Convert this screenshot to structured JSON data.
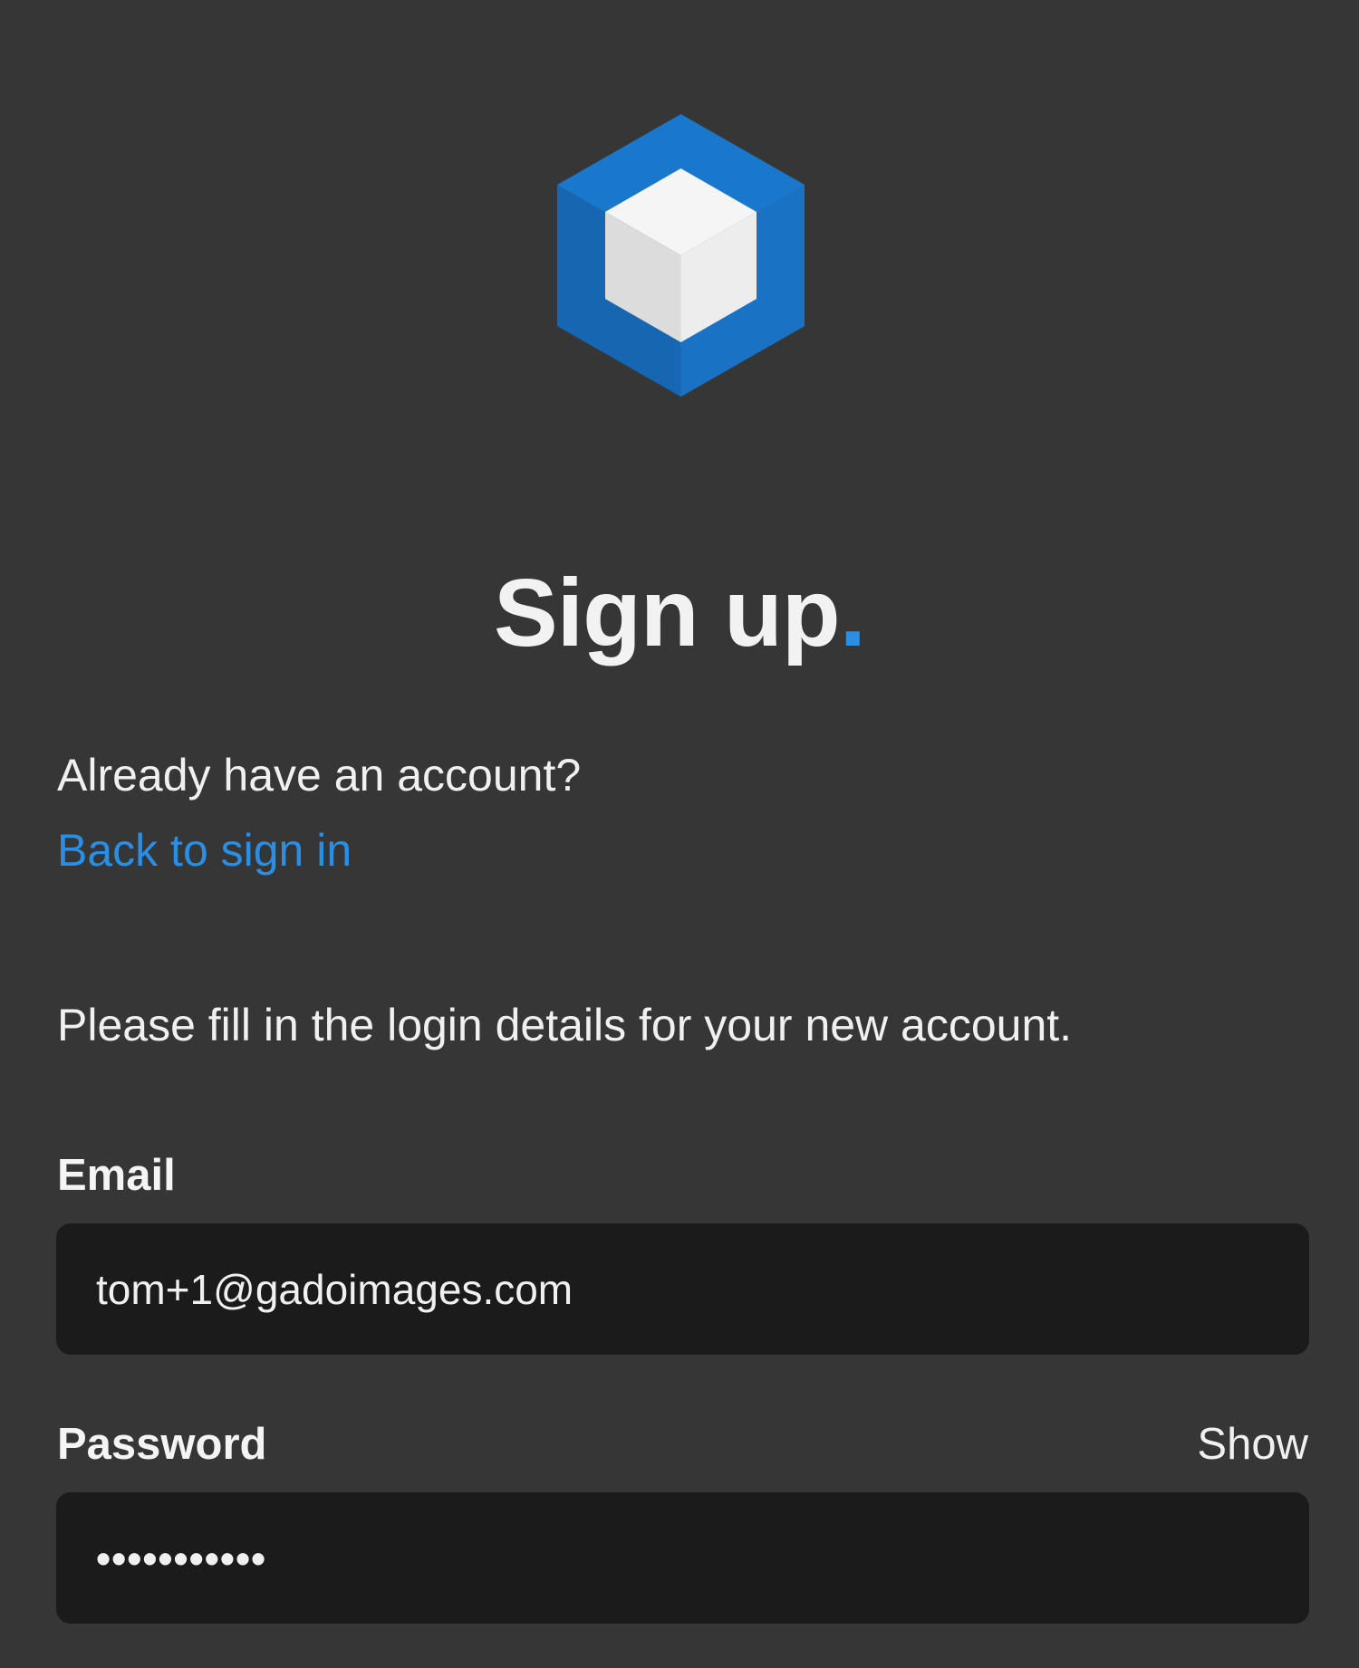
{
  "logo": {
    "icon": "cube-logo-icon",
    "colors": {
      "outer": "#1a78cc",
      "outer_dark": "#1563a8",
      "cube_top": "#f5f5f5",
      "cube_left": "#dcdcdc",
      "cube_right": "#ededed"
    }
  },
  "header": {
    "title": "Sign up",
    "title_punct": "."
  },
  "signin_prompt": {
    "text": "Already have an account?",
    "link_label": "Back to sign in"
  },
  "instructions": "Please fill in the login details for your new account.",
  "form": {
    "email": {
      "label": "Email",
      "value": "tom+1@gadoimages.com"
    },
    "password": {
      "label": "Password",
      "masked_value": "•••••••••••",
      "toggle_label": "Show"
    }
  },
  "colors": {
    "background": "#363636",
    "input_bg": "#1b1b1b",
    "accent": "#2a8ee4",
    "text": "#f0f0f0"
  }
}
